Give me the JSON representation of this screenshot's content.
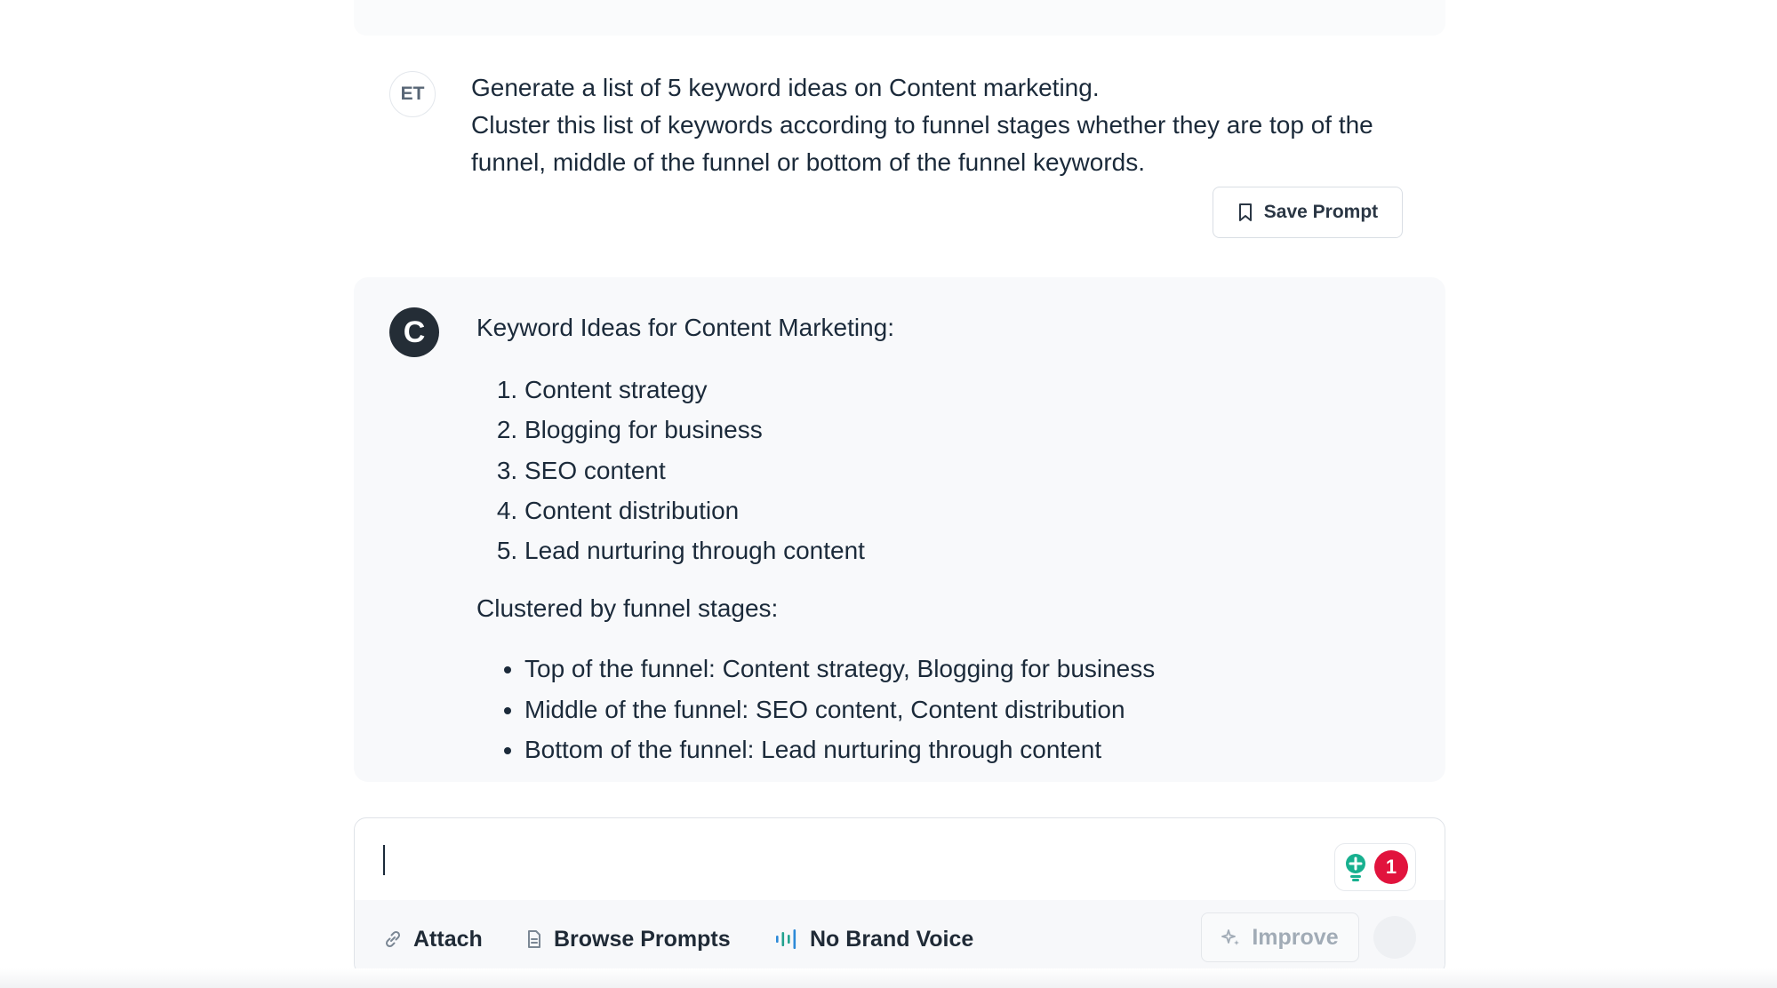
{
  "user_message": {
    "avatar_initials": "ET",
    "lines": [
      "Generate a list of 5 keyword ideas on Content marketing.",
      "Cluster this list of keywords according to funnel stages whether they are top of the funnel, middle of the funnel or bottom of the funnel keywords."
    ],
    "save_button_label": "Save Prompt"
  },
  "assistant_message": {
    "avatar_letter": "C",
    "heading": "Keyword Ideas for Content Marketing:",
    "keywords": [
      "Content strategy",
      "Blogging for business",
      "SEO content",
      "Content distribution",
      "Lead nurturing through content"
    ],
    "cluster_heading": "Clustered by funnel stages:",
    "clusters": [
      "Top of the funnel: Content strategy, Blogging for business",
      "Middle of the funnel: SEO content, Content distribution",
      "Bottom of the funnel: Lead nurturing through content"
    ]
  },
  "composer": {
    "input_value": "",
    "extension_badge_count": "1",
    "toolbar": {
      "attach_label": "Attach",
      "browse_prompts_label": "Browse Prompts",
      "brand_voice_label": "No Brand Voice",
      "improve_label": "Improve"
    }
  },
  "colors": {
    "text": "#1b2a3a",
    "assistant_avatar_bg": "#242d36",
    "badge_red": "#e1133d",
    "extension_teal": "#17b08f",
    "muted": "#a1abb6"
  },
  "icons": {
    "save": "bookmark-icon",
    "attach": "paperclip-icon",
    "browse_prompts": "document-icon",
    "brand_voice": "soundwave-icon",
    "improve": "sparkle-icon",
    "extension": "grammar-assistant-icon"
  }
}
